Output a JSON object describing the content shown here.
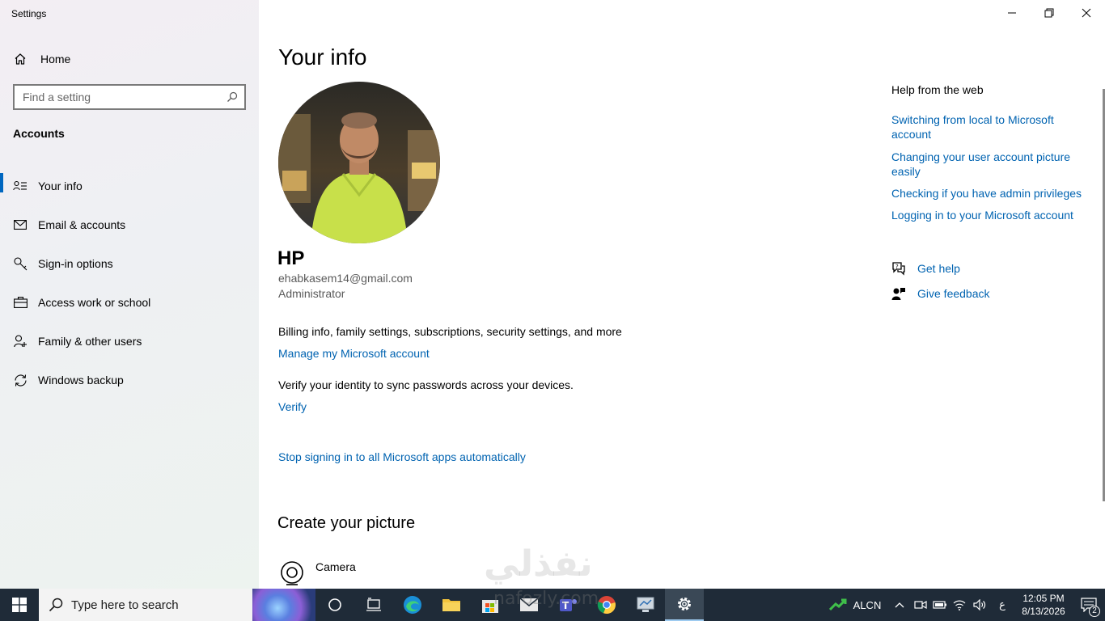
{
  "window": {
    "title": "Settings",
    "minimize_glyph": "—",
    "restore_glyph": "❐",
    "close_glyph": "✕"
  },
  "sidebar": {
    "home_label": "Home",
    "search_placeholder": "Find a setting",
    "section_title": "Accounts",
    "items": [
      {
        "label": "Your info",
        "icon": "person-card-icon",
        "active": true
      },
      {
        "label": "Email & accounts",
        "icon": "mail-icon",
        "active": false
      },
      {
        "label": "Sign-in options",
        "icon": "key-icon",
        "active": false
      },
      {
        "label": "Access work or school",
        "icon": "briefcase-icon",
        "active": false
      },
      {
        "label": "Family & other users",
        "icon": "person-add-icon",
        "active": false
      },
      {
        "label": "Windows backup",
        "icon": "sync-icon",
        "active": false
      }
    ]
  },
  "main": {
    "title": "Your info",
    "user": {
      "name": "HP",
      "email": "ehabkasem14@gmail.com",
      "role": "Administrator"
    },
    "billing_text": "Billing info, family settings, subscriptions, security settings, and more",
    "manage_link": "Manage my Microsoft account",
    "verify_text": "Verify your identity to sync passwords across your devices.",
    "verify_link": "Verify",
    "stop_link": "Stop signing in to all Microsoft apps automatically",
    "create_title": "Create your picture",
    "camera_label": "Camera"
  },
  "help": {
    "title": "Help from the web",
    "links": [
      "Switching from local to Microsoft account",
      "Changing your user account picture easily",
      "Checking if you have admin privileges",
      "Logging in to your Microsoft account"
    ],
    "get_help": "Get help",
    "give_feedback": "Give feedback"
  },
  "watermark": {
    "arabic": "نفذلي",
    "latin": "nafozly.com"
  },
  "taskbar": {
    "search_placeholder": "Type here to search",
    "tray_label": "ALCN",
    "lang": "ع",
    "time": "12:05 PM",
    "date": "8/13/2026",
    "notif_count": "2"
  },
  "colors": {
    "accent": "#0067c0",
    "link": "#0063b1",
    "taskbar": "#1f2b38"
  }
}
